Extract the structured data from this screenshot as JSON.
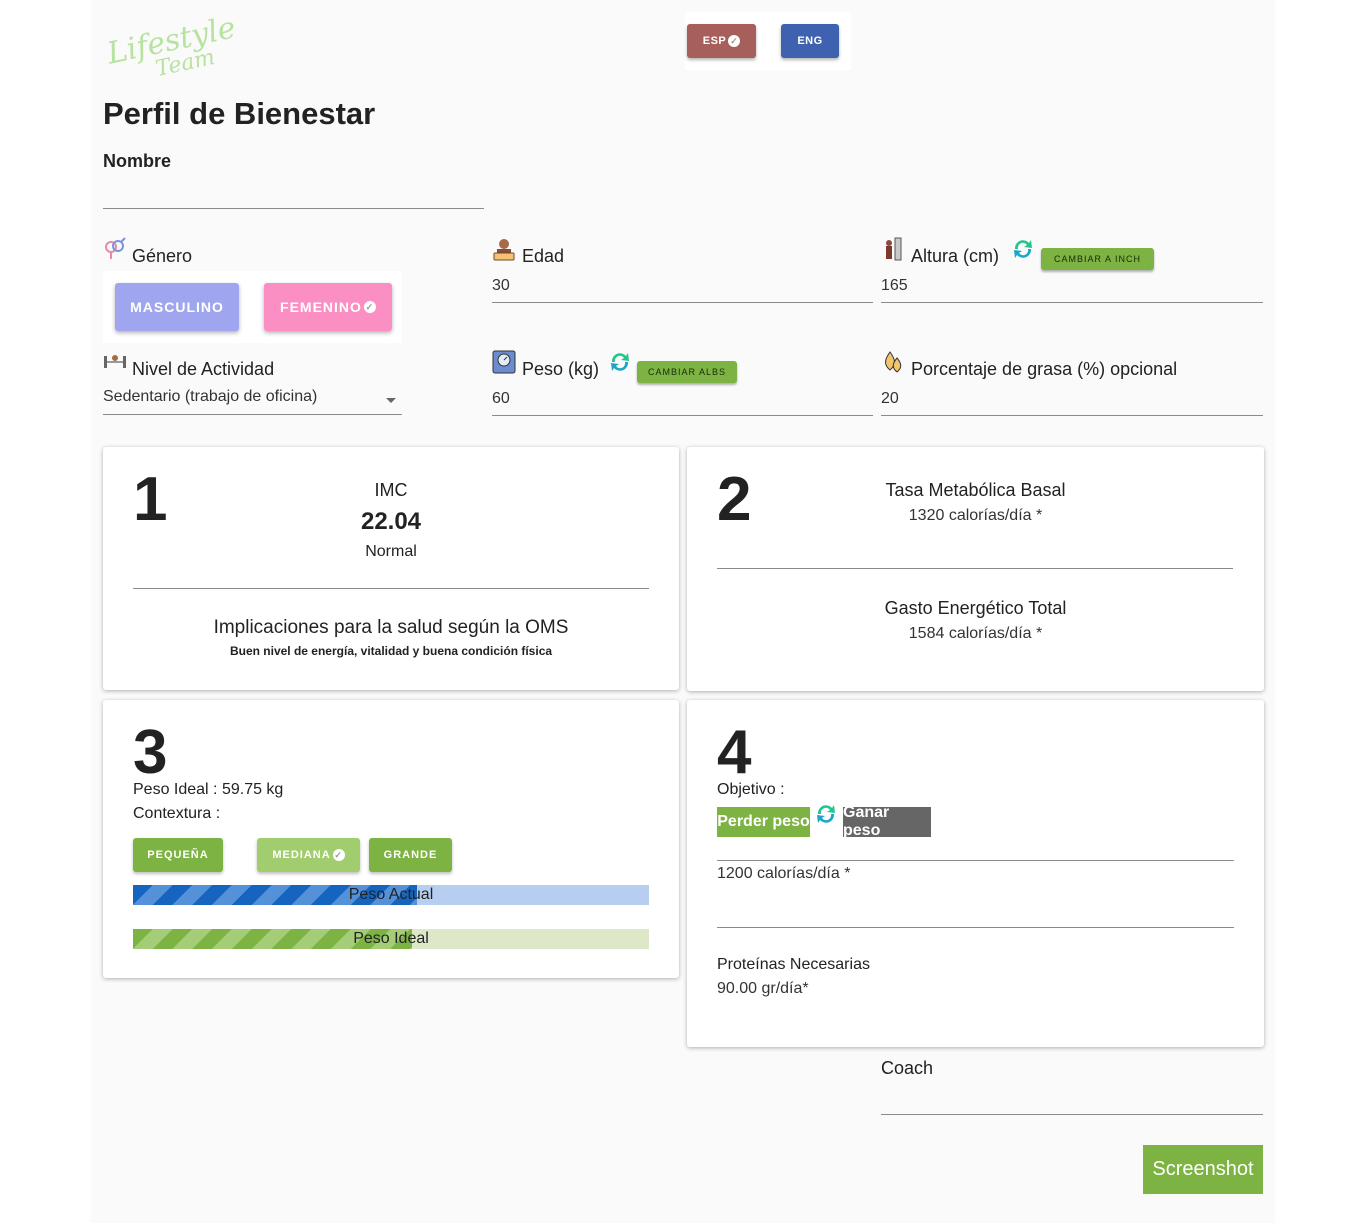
{
  "logo": {
    "text": "Lifestyle Team"
  },
  "language": {
    "esp_label": "ESP",
    "eng_label": "ENG",
    "esp_color": "#a75f5c",
    "eng_color": "#3f62b0"
  },
  "page_title": "Perfil de Bienestar",
  "name_field": {
    "label": "Nombre",
    "value": ""
  },
  "gender": {
    "label": "Género",
    "male_label": "MASCULINO",
    "female_label": "FEMENINO",
    "male_color": "#9fa6ef",
    "female_color": "#fb8ec2"
  },
  "age": {
    "label": "Edad",
    "value": "30"
  },
  "height": {
    "label": "Altura (cm)",
    "switch_label": "CAMBIAR A  INCH",
    "value": "165"
  },
  "activity": {
    "label": "Nivel de Actividad",
    "selected": "Sedentario (trabajo de oficina)"
  },
  "weight": {
    "label": "Peso (kg)",
    "switch_label": "CAMBIAR ALBS",
    "value": "60"
  },
  "fat": {
    "label": "Porcentaje de grasa (%) opcional",
    "value": "20"
  },
  "card1": {
    "number": "1",
    "imc_label": "IMC",
    "imc_value": "22.04",
    "imc_status": "Normal",
    "oms_title": "Implicaciones para la salud según la OMS",
    "oms_text": "Buen nivel de energía, vitalidad y buena condición física"
  },
  "card2": {
    "number": "2",
    "tmb_title": "Tasa Metabólica Basal",
    "tmb_value": "1320 calorías/día *",
    "get_title": "Gasto Energético Total",
    "get_value": "1584 calorías/día *"
  },
  "card3": {
    "number": "3",
    "ideal_weight": "Peso Ideal : 59.75 kg",
    "build_label": "Contextura :",
    "small_label": "PEQUEÑA",
    "medium_label": "MEDIANA",
    "large_label": "GRANDE",
    "actual_bar_label": "Peso Actual",
    "ideal_bar_label": "Peso Ideal",
    "actual_fraction": 0.55,
    "ideal_fraction": 0.54
  },
  "card4": {
    "number": "4",
    "goal_label": "Objetivo :",
    "lose_label": "Perder peso",
    "gain_label": "Ganar peso",
    "calories": "1200 calorías/día *",
    "protein_label": "Proteínas Necesarias",
    "protein_value": "90.00 gr/día*"
  },
  "coach": {
    "label": "Coach",
    "value": ""
  },
  "screenshot_label": "Screenshot",
  "colors": {
    "green": "#7cb342",
    "gray": "#666666",
    "blue_bar": "#1565c0",
    "blue_bar_bg": "#b6cff0",
    "green_bar_bg": "#dce8c8"
  }
}
